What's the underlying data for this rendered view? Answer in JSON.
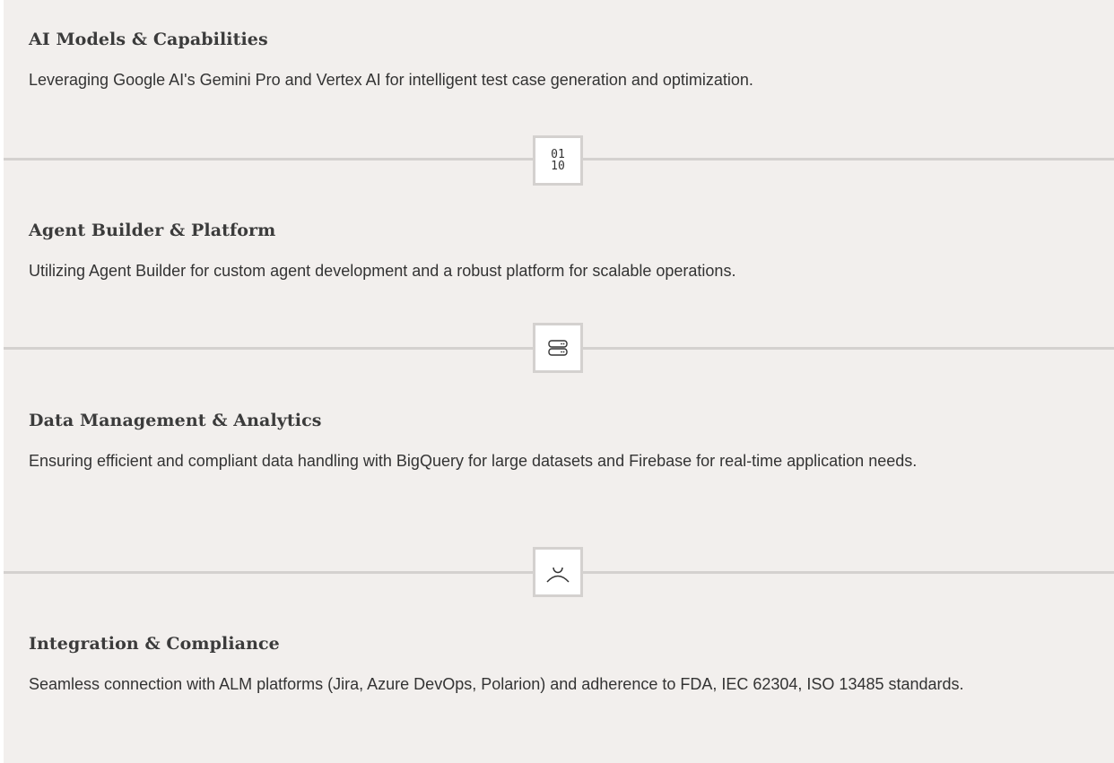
{
  "sections": [
    {
      "title": "AI Models & Capabilities",
      "description": "Leveraging Google AI's Gemini Pro and Vertex AI for intelligent test case generation and optimization."
    },
    {
      "title": "Agent Builder & Platform",
      "description": "Utilizing Agent Builder for custom agent development and a robust platform for scalable operations."
    },
    {
      "title": "Data Management & Analytics",
      "description": "Ensuring efficient and compliant data handling with BigQuery for large datasets and Firebase for real-time application needs."
    },
    {
      "title": "Integration & Compliance",
      "description": "Seamless connection with ALM platforms (Jira, Azure DevOps, Polarion) and adherence to FDA, IEC 62304, ISO 13485 standards."
    }
  ],
  "icons": [
    {
      "name": "binary-code-icon",
      "text_line1": "01",
      "text_line2": "10"
    },
    {
      "name": "server-stack-icon"
    },
    {
      "name": "user-icon"
    }
  ]
}
